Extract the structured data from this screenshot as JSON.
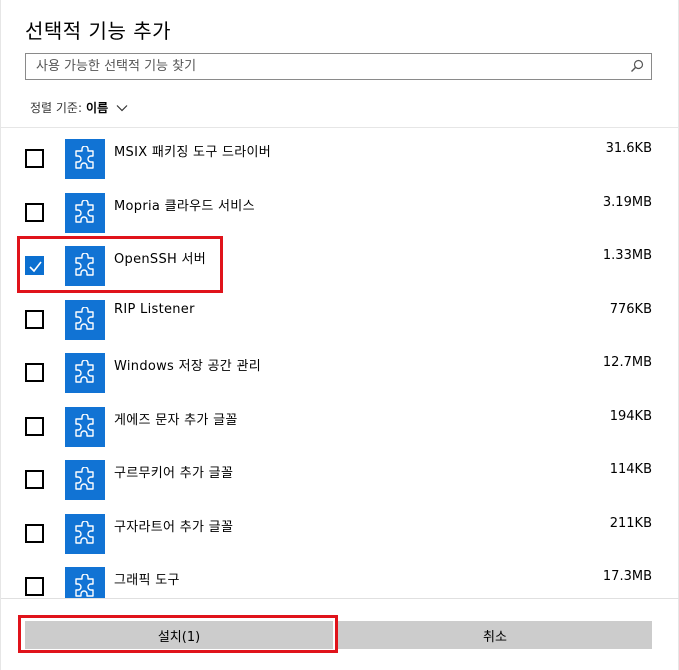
{
  "dialog": {
    "title": "선택적 기능 추가",
    "search": {
      "placeholder": "사용 가능한 선택적 기능 찾기",
      "value": "",
      "icon": "search-icon"
    },
    "sort": {
      "label": "정렬 기준:",
      "value": "이름",
      "icon": "chevron-down-icon"
    },
    "features": [
      {
        "name": "MSIX 패키징 도구 드라이버",
        "size": "31.6KB",
        "checked": false
      },
      {
        "name": "Mopria 클라우드 서비스",
        "size": "3.19MB",
        "checked": false
      },
      {
        "name": "OpenSSH 서버",
        "size": "1.33MB",
        "checked": true
      },
      {
        "name": "RIP Listener",
        "size": "776KB",
        "checked": false
      },
      {
        "name": "Windows 저장 공간 관리",
        "size": "12.7MB",
        "checked": false
      },
      {
        "name": "게에즈 문자 추가 글꼴",
        "size": "194KB",
        "checked": false
      },
      {
        "name": "구르무키어 추가 글꼴",
        "size": "114KB",
        "checked": false
      },
      {
        "name": "구자라트어 추가 글꼴",
        "size": "211KB",
        "checked": false
      },
      {
        "name": "그래픽 도구",
        "size": "17.3MB",
        "checked": false
      }
    ],
    "buttons": {
      "install_label": "설치(1)",
      "cancel_label": "취소"
    },
    "colors": {
      "accent": "#0b6fd0",
      "feature_icon_bg": "#1173d4",
      "button_bg": "#cccccc",
      "highlight": "#e0131b"
    }
  }
}
